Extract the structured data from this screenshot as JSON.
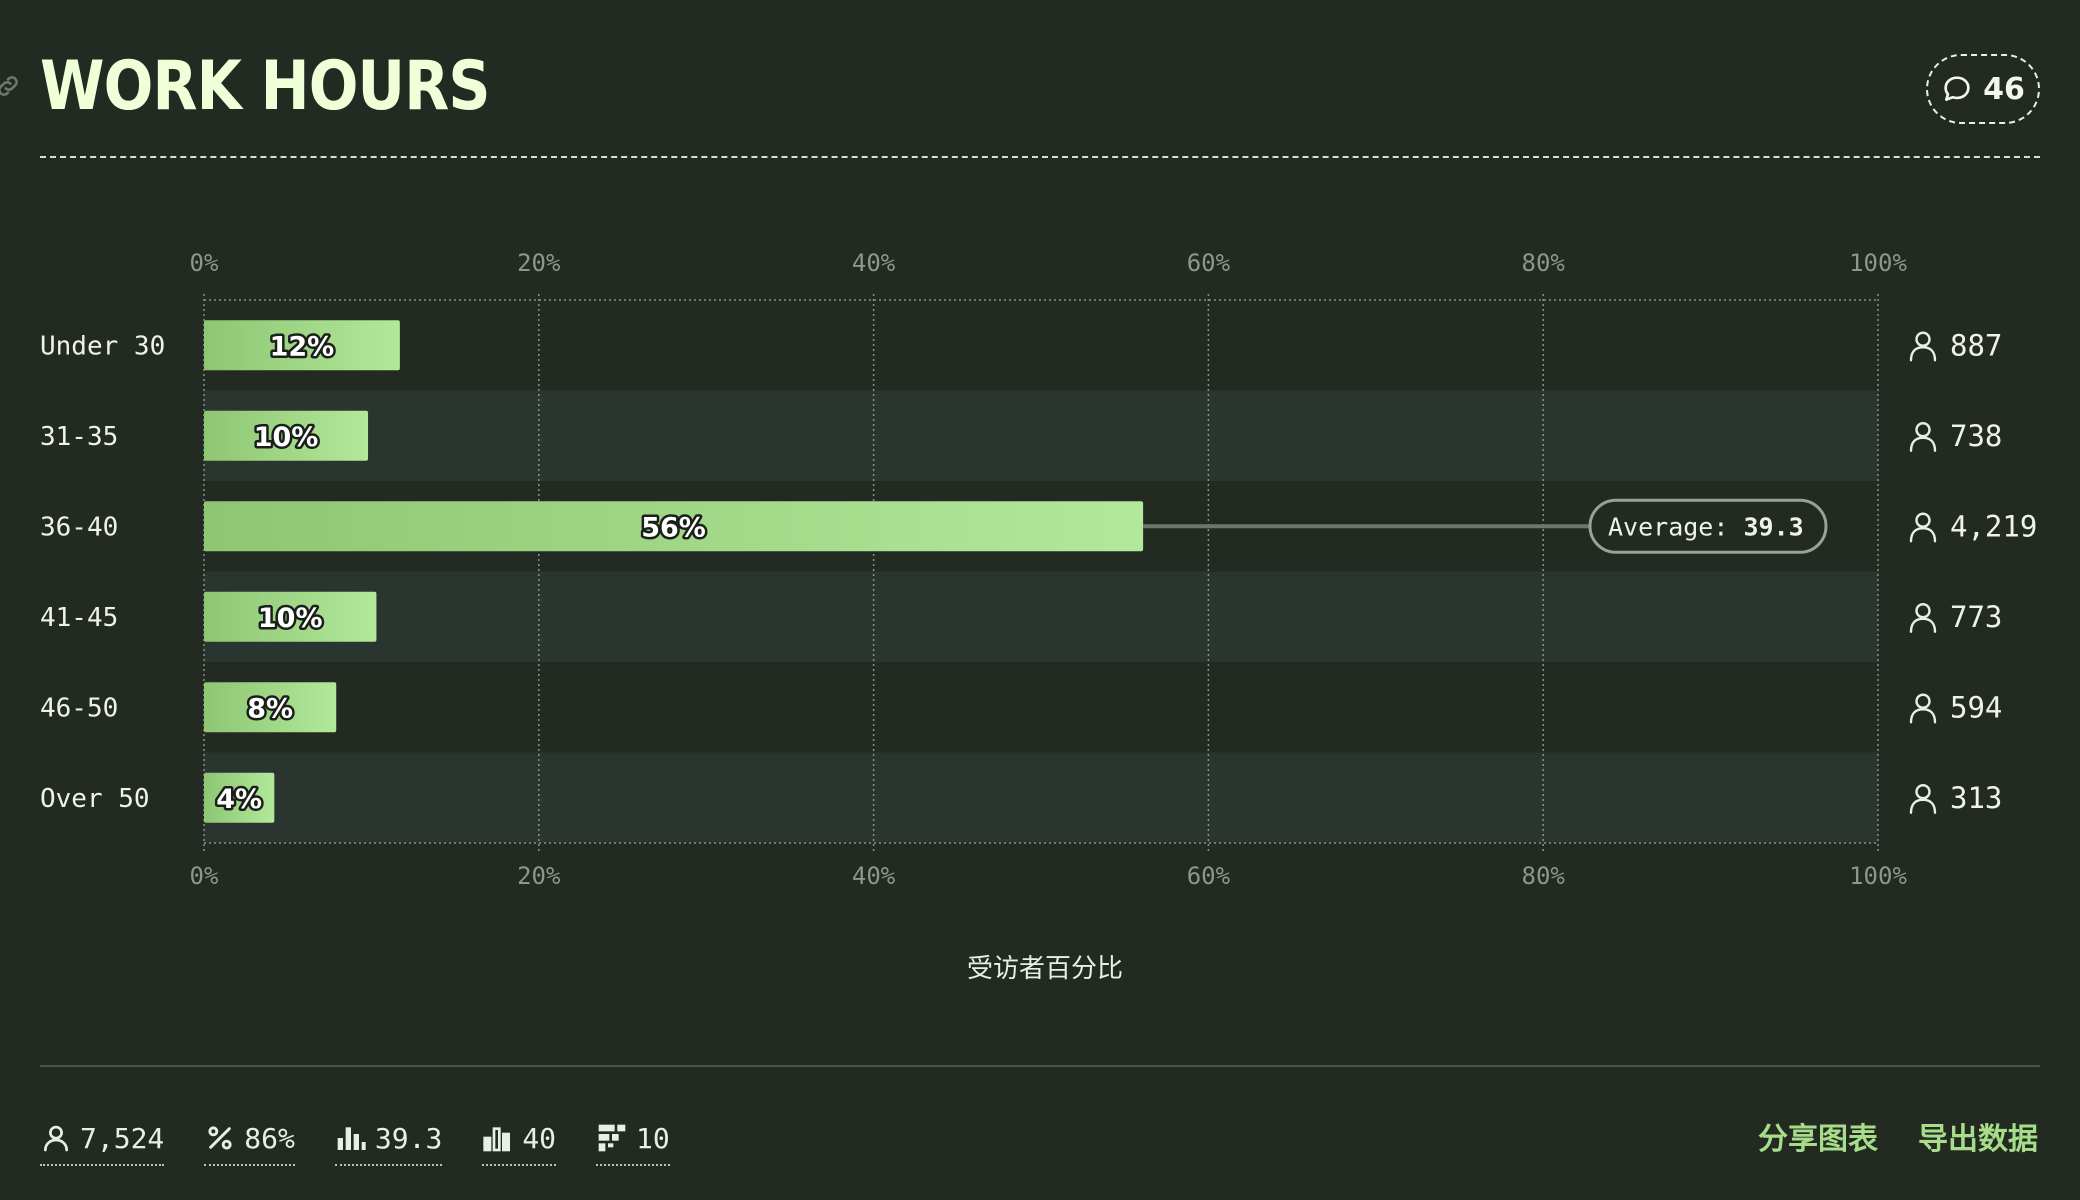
{
  "header": {
    "title": "WORK HOURS",
    "comment_count": "46"
  },
  "chart_data": {
    "type": "bar",
    "orientation": "horizontal",
    "title": "WORK HOURS",
    "xlabel": "受访者百分比",
    "xlim": [
      0,
      100
    ],
    "xticks": [
      "0%",
      "20%",
      "40%",
      "60%",
      "80%",
      "100%"
    ],
    "categories": [
      "Under 30",
      "31-35",
      "36-40",
      "41-45",
      "46-50",
      "Over 50"
    ],
    "values": [
      11.7,
      9.8,
      56.1,
      10.3,
      7.9,
      4.2
    ],
    "value_labels": [
      "12%",
      "10%",
      "56%",
      "10%",
      "8%",
      "4%"
    ],
    "counts": [
      "887",
      "738",
      "4,219",
      "773",
      "594",
      "313"
    ],
    "average": {
      "label": "Average:",
      "value": "39.3",
      "category": "36-40"
    },
    "grid": true,
    "colors": {
      "bar_start": "#8ec673",
      "bar_end": "#b2e89a",
      "band": "#2b352f",
      "grid": "#8a9186"
    }
  },
  "footer": {
    "stats": [
      {
        "icon": "person-icon",
        "value": "7,524"
      },
      {
        "icon": "percent-icon",
        "value": "86%"
      },
      {
        "icon": "bar-chart-icon",
        "value": "39.3"
      },
      {
        "icon": "median-chart-icon",
        "value": "40"
      },
      {
        "icon": "grid-chart-icon",
        "value": "10"
      }
    ],
    "share_label": "分享图表",
    "export_label": "导出数据"
  }
}
